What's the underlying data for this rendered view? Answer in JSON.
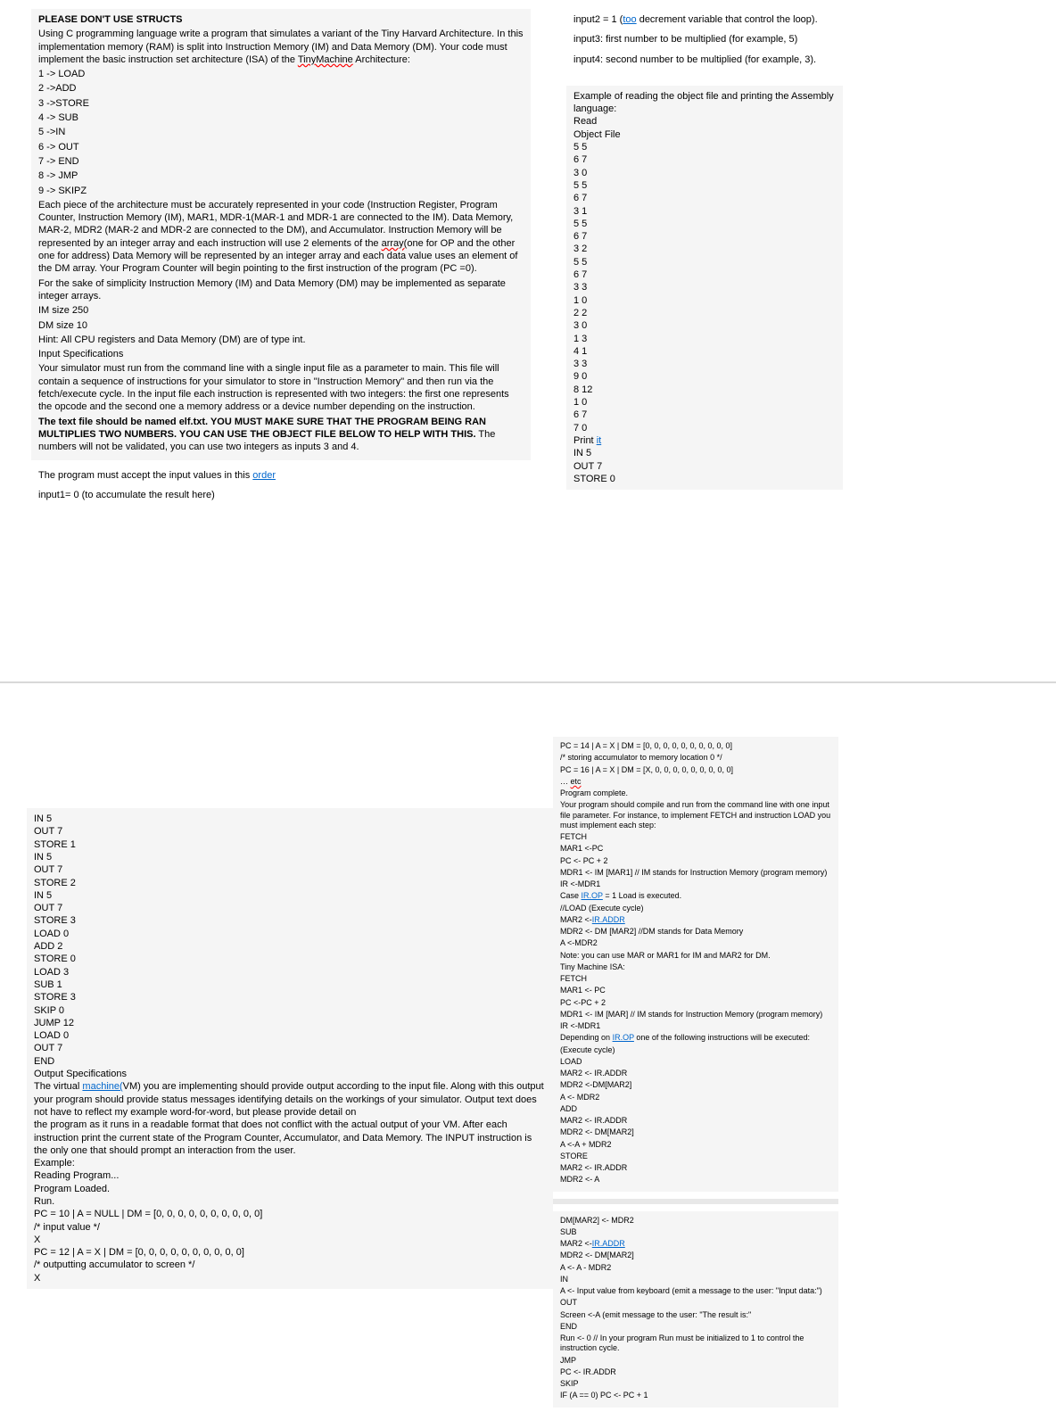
{
  "head": {
    "title": "PLEASE DON'T USE STRUCTS",
    "intro1": "Using C programming language write a program that simulates a variant of the Tiny Harvard Architecture. In this implementation memory (RAM) is split into Instruction Memory (IM) and Data Memory (DM). Your code must implement the basic instruction set architecture (ISA) of the ",
    "tinyMachine": "TinyMachine",
    "intro1b": " Architecture:",
    "isa": [
      "1 -> LOAD",
      "2 ->ADD",
      "3 ->STORE",
      "4 -> SUB",
      "5 ->IN",
      "6 -> OUT",
      "7 -> END",
      "8 -> JMP",
      "9 -> SKIPZ"
    ],
    "para2a": "Each piece of the architecture must be accurately represented in your code (Instruction Register, Program Counter, Instruction Memory (IM), MAR1, MDR-1(MAR-1 and MDR-1 are connected to the IM). Data Memory, MAR-2, MDR2 (MAR-2 and MDR-2 are connected to the DM), and Accumulator. Instruction Memory will be represented by an integer array and each instruction will use 2 elements of the ",
    "arrayWord": "array(",
    "para2b": "one for OP and the other one for address) Data Memory will be represented by an integer array and each data value uses an element of the DM array. Your Program Counter will begin pointing to the first instruction of the program (PC =0).",
    "para3": "For the sake of simplicity Instruction Memory (IM) and Data Memory (DM) may be implemented as separate integer arrays.",
    "im": "IM size 250",
    "dm": "DM size 10",
    "hint": "Hint: All CPU registers and Data Memory (DM) are of type int.",
    "inspec": "Input Specifications",
    "para4": "Your simulator must run from the command line with a single input file as a parameter to main. This file will contain a sequence of instructions for your simulator to store in \"Instruction Memory\" and then run via the fetch/execute cycle. In the input file each instruction is represented with two integers: the first one represents the opcode and the second one a memory address or a device number depending on the instruction.",
    "para5a": "The text file should be named elf.txt. YOU MUST MAKE SURE THAT THE PROGRAM BEING RAN MULTIPLIES TWO NUMBERS. YOU CAN USE THE OBJECT FILE BELOW TO HELP WITH THIS.",
    "para5b": " The numbers will not be validated, you can use two integers as inputs 3 and 4.",
    "para6a": "The program must accept the input values in this ",
    "orderWord": "order",
    "input1": "input1= 0 (to accumulate the result here)"
  },
  "right": {
    "input2a": "input2 = 1 (",
    "tooWord": "too",
    "input2b": " decrement variable that control the loop).",
    "input3": "input3: first number to be multiplied (for example, 5)",
    "input4": "input4: second number to be multiplied (for example, 3).",
    "exTitle": "Example of reading the object file and printing the Assembly language:",
    "read": "Read",
    "objFile": "Object File",
    "objLines": [
      "5 5",
      "6 7",
      "3 0",
      "5 5",
      "6 7",
      "3 1",
      "5 5",
      "6 7",
      "3 2",
      "5 5",
      "6 7",
      "3 3",
      "1 0",
      "2 2",
      "3 0",
      "1 3",
      "4 1",
      "3 3",
      "9 0",
      "8 12",
      "1 0",
      "6 7",
      "7 0"
    ],
    "print": "Print ",
    "itWord": "it",
    "printLines": [
      "IN 5",
      "OUT 7",
      "STORE 0"
    ]
  },
  "s2left": {
    "asmLines": [
      "IN 5",
      "OUT 7",
      "STORE 1",
      "IN 5",
      "OUT 7",
      "STORE 2",
      "IN 5",
      "OUT 7",
      "STORE 3",
      "LOAD 0",
      "ADD 2",
      "STORE 0",
      "LOAD 3",
      "SUB 1",
      "STORE 3",
      "SKIP 0",
      "JUMP 12",
      "LOAD 0",
      "OUT 7",
      "END"
    ],
    "outSpec": "Output Specifications",
    "p1a": "The virtual ",
    "machineWord": "machine(",
    "p1b": "VM) you are implementing should provide output according to the input file. Along with this output your program should provide status messages identifying details on the workings of your simulator. Output text does not have to reflect my example word-for-word, but please provide detail on",
    "p2": "the program as it runs in a readable format that does not conflict with the actual output of your VM. After each instruction print the current state of the Program Counter, Accumulator, and Data Memory. The INPUT instruction is the only one that should prompt an interaction from the user.",
    "ex": "Example:",
    "lines": [
      "Reading Program...",
      "Program Loaded.",
      "Run.",
      "PC = 10 | A = NULL | DM = [0, 0, 0, 0, 0, 0, 0, 0, 0, 0]",
      "/* input value */",
      "X",
      "PC = 12 | A = X | DM = [0, 0, 0, 0, 0, 0, 0, 0, 0, 0]",
      "/* outputting accumulator to screen */",
      "X"
    ]
  },
  "s2right1": {
    "l1": "PC = 14 | A = X | DM = [0, 0, 0, 0, 0, 0, 0, 0, 0, 0]",
    "l2": "/* storing accumulator to memory location 0 */",
    "l3": "PC = 16 | A = X | DM = [X, 0, 0, 0, 0, 0, 0, 0, 0, 0]",
    "l4a": "… ",
    "etcWord": "etc",
    "l5": "Program complete.",
    "l6": "Your program should compile and run from the command line with one input file parameter. For instance, to implement FETCH and instruction LOAD you must implement each step:",
    "steps1": [
      "FETCH",
      "MAR1 <-PC",
      "PC <- PC + 2",
      "MDR1 <- IM [MAR1] // IM stands for Instruction Memory (program memory)",
      "IR <-MDR1"
    ],
    "caseA": "Case ",
    "irop": "IR.OP",
    "caseB": " = 1 Load is executed.",
    "load1": "//LOAD (Execute cycle)",
    "mar2a": "MAR2 <-",
    "iraddr": "IR.ADDR",
    "steps2": [
      "MDR2 <- DM [MAR2] //DM stands for Data Memory",
      "A <-MDR2",
      "Note: you can use MAR or MAR1 for IM and MAR2 for DM.",
      "Tiny Machine ISA:",
      "FETCH",
      "MAR1 <- PC",
      "PC <-PC + 2",
      "MDR1 <- IM [MAR] // IM stands for Instruction Memory (program memory)",
      "IR <-MDR1"
    ],
    "depA": "Depending on ",
    "depB": " one of the following instructions will be executed:",
    "steps3": [
      "(Execute cycle)",
      "LOAD",
      "MAR2 <- IR.ADDR",
      "MDR2 <-DM[MAR2]",
      "A <- MDR2",
      "ADD",
      "MAR2 <- IR.ADDR",
      "MDR2 <- DM[MAR2]",
      "A <-A + MDR2",
      "STORE",
      "MAR2 <- IR.ADDR",
      "MDR2 <- A"
    ]
  },
  "s2right2": {
    "l1": "DM[MAR2] <- MDR2",
    "l2": "SUB",
    "l3a": "MAR2 <-",
    "iraddr": "IR.ADDR",
    "lines": [
      "MDR2 <- DM[MAR2]",
      "A <- A - MDR2",
      "IN",
      "A <- Input value from keyboard (emit a message to the user: \"Input data:\")",
      "OUT",
      "Screen <-A (emit message to the user: \"The result is:\"",
      "END",
      "Run <- 0 // In your program Run must be initialized to 1 to control the instruction cycle.",
      "JMP",
      "PC <- IR.ADDR",
      "SKIP",
      "IF (A == 0) PC <- PC + 1"
    ]
  }
}
